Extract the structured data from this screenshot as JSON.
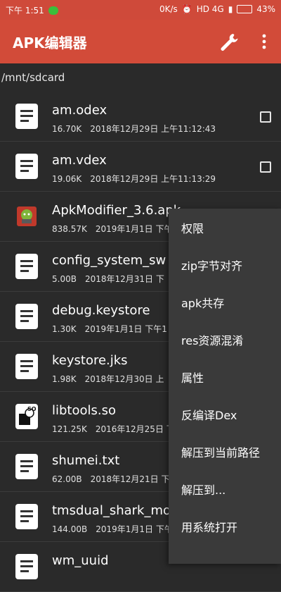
{
  "status": {
    "time": "下午 1:51",
    "speed": "0K/s",
    "network": "HD 4G",
    "battery": "43%"
  },
  "appbar": {
    "title": "APK编辑器",
    "wrench_icon": "wrench-icon",
    "more_icon": "more-vertical-icon",
    "bg": "#d24b39"
  },
  "path": "/mnt/sdcard",
  "files": [
    {
      "name": "am.odex",
      "size": "16.70K",
      "date": "2018年12月29日 上午11:12:43",
      "icon": "document-icon",
      "checkbox": true
    },
    {
      "name": "am.vdex",
      "size": "19.06K",
      "date": "2018年12月29日 上午11:13:29",
      "icon": "document-icon",
      "checkbox": true
    },
    {
      "name": "ApkModifier_3.6.apk",
      "size": "838.57K",
      "date": "2019年1月1日 下午",
      "icon": "apk-icon",
      "checkbox": false
    },
    {
      "name": "config_system_sw",
      "size": "5.00B",
      "date": "2018年12月31日 下",
      "icon": "document-icon",
      "checkbox": false
    },
    {
      "name": "debug.keystore",
      "size": "1.30K",
      "date": "2019年1月1日 下午1",
      "icon": "document-icon",
      "checkbox": false
    },
    {
      "name": "keystore.jks",
      "size": "1.98K",
      "date": "2018年12月30日 上",
      "icon": "document-icon",
      "checkbox": false
    },
    {
      "name": "libtools.so",
      "size": "121.25K",
      "date": "2016年12月25日 下",
      "icon": "so-file-icon",
      "checkbox": false
    },
    {
      "name": "shumei.txt",
      "size": "62.00B",
      "date": "2018年12月21日 下",
      "icon": "document-icon",
      "checkbox": false
    },
    {
      "name": "tmsdual_shark_mo",
      "size": "144.00B",
      "date": "2019年1月1日 下午",
      "icon": "document-icon",
      "checkbox": false
    },
    {
      "name": "wm_uuid",
      "size": "",
      "date": "",
      "icon": "document-icon",
      "checkbox": false
    }
  ],
  "menu": [
    "权限",
    "zip字节对齐",
    "apk共存",
    "res资源混淆",
    "属性",
    "反编译Dex",
    "解压到当前路径",
    "解压到...",
    "用系统打开"
  ]
}
